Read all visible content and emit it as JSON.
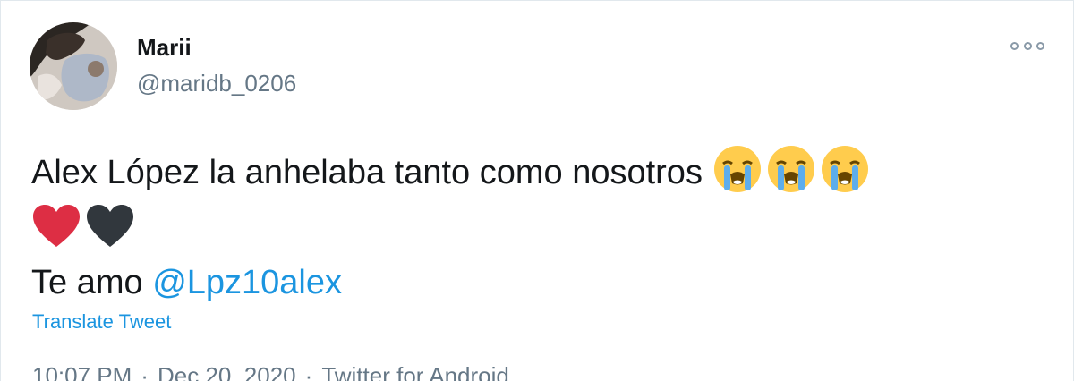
{
  "user": {
    "name": "Marii",
    "handle": "@maridb_0206"
  },
  "tweet": {
    "text_line1": "Alex López la anhelaba tanto como nosotros",
    "emojis_line1": [
      "loudly-crying-face",
      "loudly-crying-face",
      "loudly-crying-face"
    ],
    "emojis_line2": [
      "red-heart",
      "black-heart"
    ],
    "text_line3_prefix": "Te amo",
    "mention": "@Lpz10alex"
  },
  "translate_label": "Translate Tweet",
  "meta": {
    "time": "10:07 PM",
    "separator": "·",
    "date": "Dec 20, 2020",
    "source": "Twitter for Android"
  },
  "colors": {
    "link": "#1b95e0",
    "secondary": "#657786",
    "text": "#14171a",
    "heart_red": "#dd2e44",
    "heart_black": "#31373d",
    "emoji_face": "#ffcc4d"
  }
}
